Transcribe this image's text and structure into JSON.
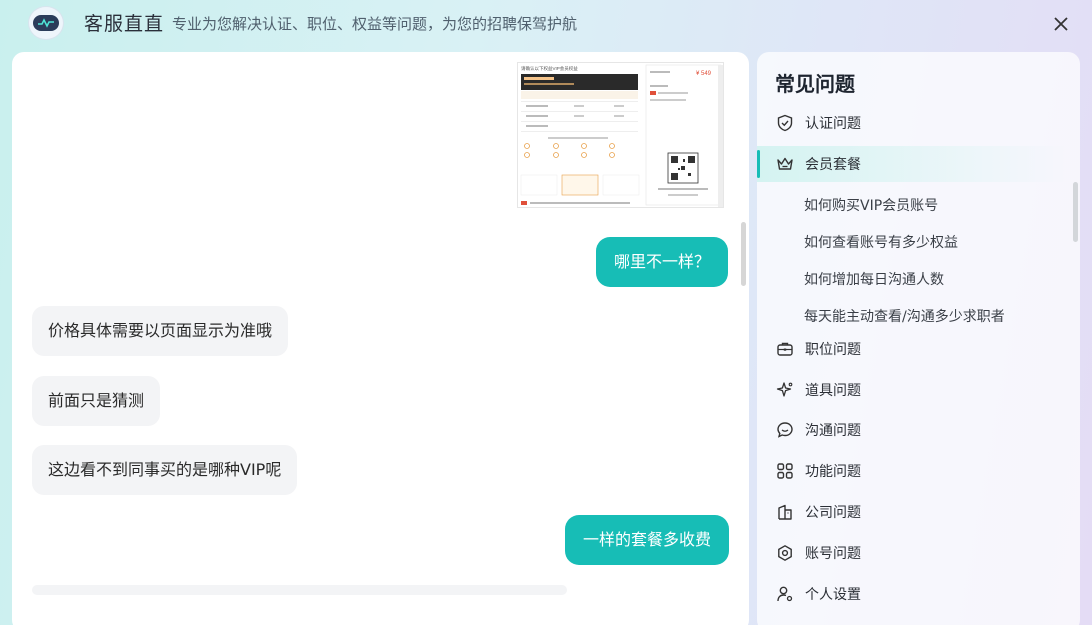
{
  "header": {
    "title": "客服直直",
    "subtitle": "专业为您解决认证、职位、权益等问题，为您的招聘保驾护航"
  },
  "chat": {
    "shot": {
      "heading": "请确认以下权益VIP会员权益",
      "price": "¥ 549"
    },
    "messages": [
      {
        "role": "user",
        "text": "哪里不一样？"
      },
      {
        "role": "bot",
        "text": "价格具体需要以页面显示为准哦"
      },
      {
        "role": "bot",
        "text": "前面只是猜测"
      },
      {
        "role": "bot",
        "text": "这边看不到同事买的是哪种VIP呢"
      },
      {
        "role": "user",
        "text": "一样的套餐多收费"
      }
    ]
  },
  "faq": {
    "title": "常见问题",
    "categories": [
      {
        "label": "认证问题",
        "icon": "shield-check-icon"
      },
      {
        "label": "会员套餐",
        "icon": "crown-icon",
        "active": true
      },
      {
        "label": "职位问题",
        "icon": "briefcase-icon"
      },
      {
        "label": "道具问题",
        "icon": "sparkle-icon"
      },
      {
        "label": "沟通问题",
        "icon": "chat-icon"
      },
      {
        "label": "功能问题",
        "icon": "grid-icon"
      },
      {
        "label": "公司问题",
        "icon": "building-icon"
      },
      {
        "label": "账号问题",
        "icon": "hexagon-settings-icon"
      },
      {
        "label": "个人设置",
        "icon": "user-settings-icon"
      }
    ],
    "sub_items": [
      "如何购买VIP会员账号",
      "如何查看账号有多少权益",
      "如何增加每日沟通人数",
      "每天能主动查看/沟通多少求职者"
    ]
  },
  "colors": {
    "accent": "#17bdb6",
    "bot_bubble": "#f3f4f6"
  }
}
